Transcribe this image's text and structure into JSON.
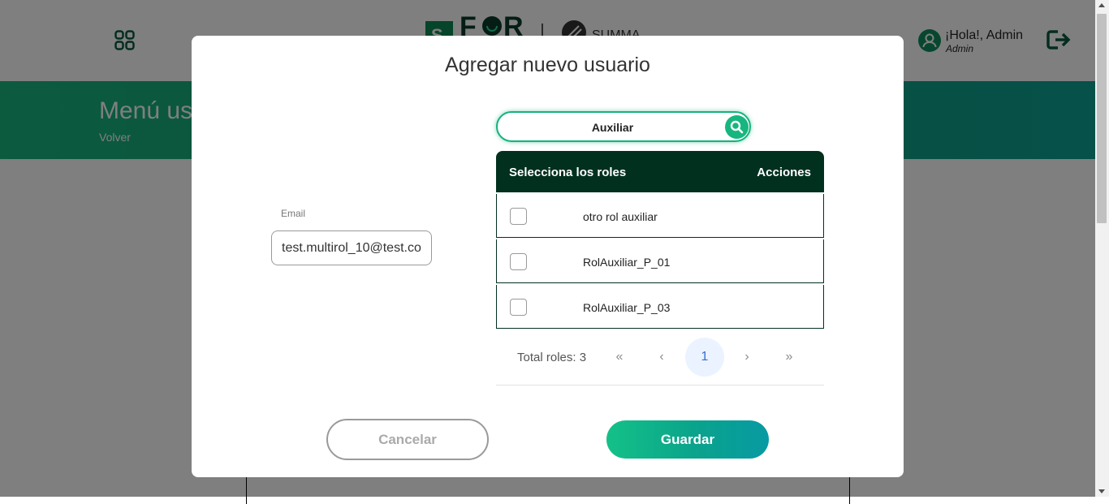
{
  "header": {
    "user_greeting": "¡Hola!, Admin",
    "user_role": "Admin"
  },
  "banner": {
    "title": "Menú us",
    "back_link": "Volver"
  },
  "modal": {
    "title": "Agregar nuevo usuario",
    "email": {
      "label": "Email",
      "value": "test.multirol_10@test.co"
    },
    "search": {
      "value": "Auxiliar"
    },
    "roles_table": {
      "header_roles": "Selecciona los roles",
      "header_actions": "Acciones",
      "rows": [
        {
          "name": "otro rol auxiliar",
          "checked": false
        },
        {
          "name": "RolAuxiliar_P_01",
          "checked": false
        },
        {
          "name": "RolAuxiliar_P_03",
          "checked": false
        }
      ]
    },
    "pagination": {
      "total_label": "Total roles: 3",
      "first": "«",
      "prev": "‹",
      "current_page": "1",
      "next": "›",
      "last": "»"
    },
    "buttons": {
      "cancel": "Cancelar",
      "save": "Guardar"
    }
  },
  "colors": {
    "brand_green": "#17b67f",
    "table_header": "#02301f",
    "overlay": "rgba(0,0,0,0.5)"
  }
}
